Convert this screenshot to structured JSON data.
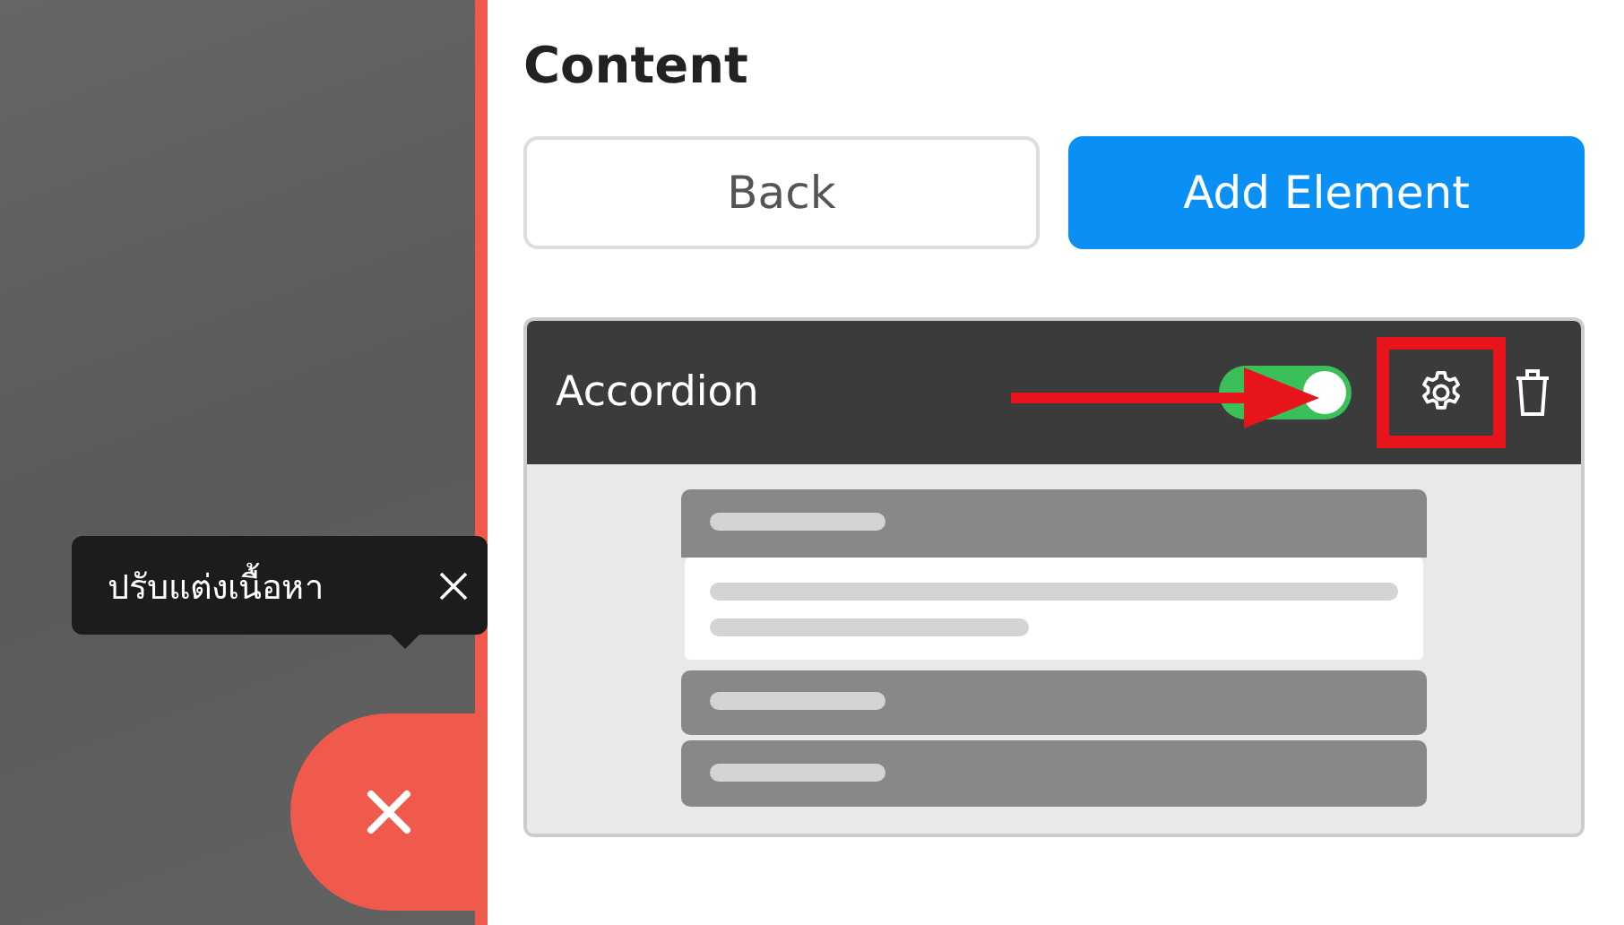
{
  "panel": {
    "title": "Content"
  },
  "buttons": [
    {
      "label": "Back",
      "kind": "secondary"
    },
    {
      "label": "Add Element",
      "kind": "primary"
    }
  ],
  "element": {
    "title": "Accordion",
    "on": true,
    "highlighted": true
  },
  "tooltip": {
    "text": "ปรับแต่งเนื้อหา"
  }
}
